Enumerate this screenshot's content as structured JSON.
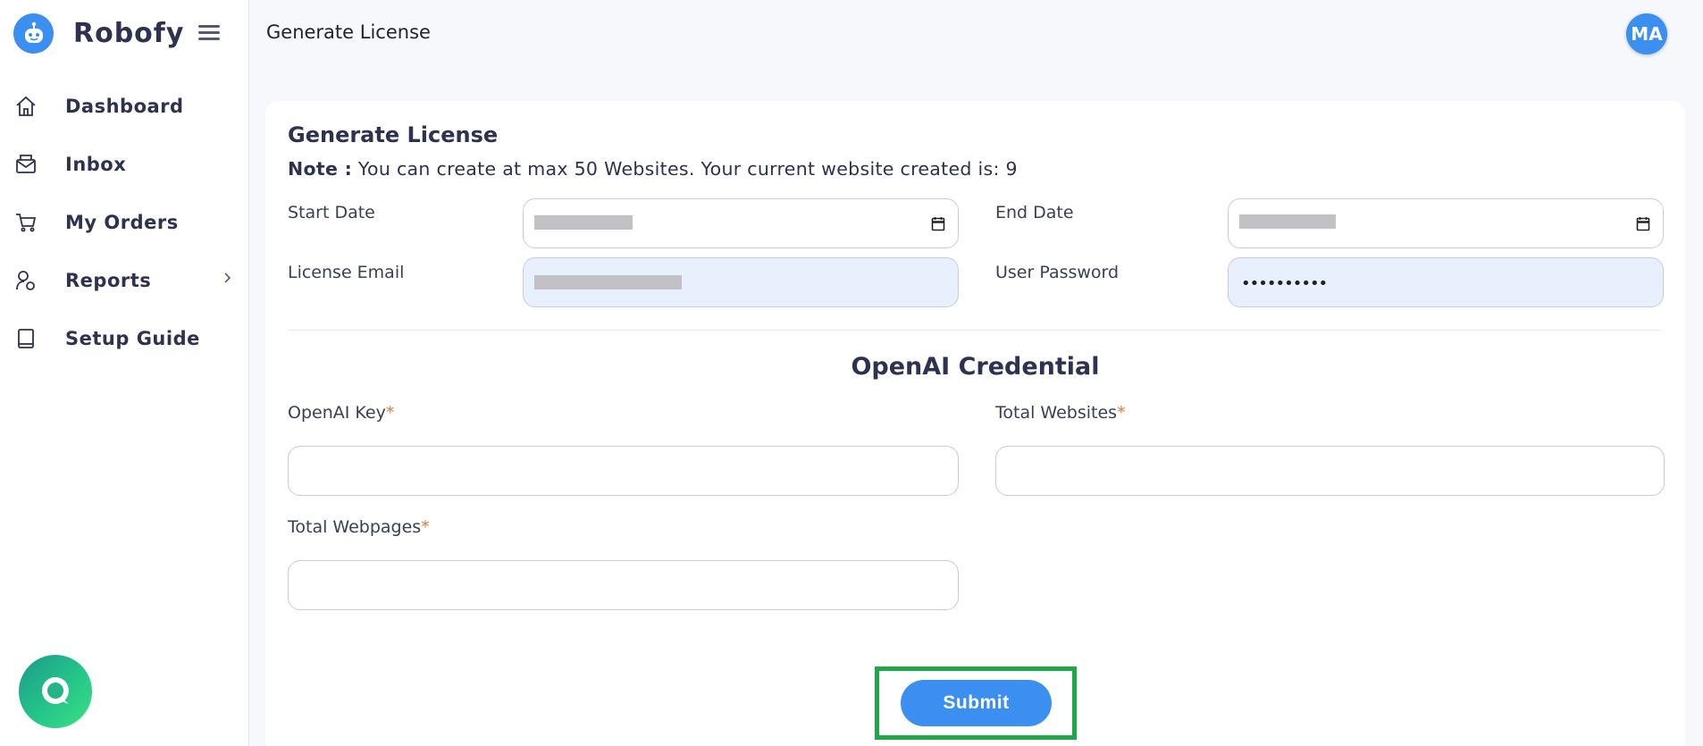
{
  "app": {
    "brand_name": "Robofy",
    "avatar_initials": "MA",
    "accent_color": "#3b8ff0"
  },
  "sidebar": {
    "items": [
      {
        "label": "Dashboard",
        "icon": "home-icon"
      },
      {
        "label": "Inbox",
        "icon": "inbox-icon"
      },
      {
        "label": "My Orders",
        "icon": "cart-icon"
      },
      {
        "label": "Reports",
        "icon": "reports-icon"
      },
      {
        "label": "Setup Guide",
        "icon": "book-icon"
      }
    ]
  },
  "header": {
    "title": "Generate License"
  },
  "form": {
    "title": "Generate License",
    "note_label": "Note :",
    "note_text": " You can create at max 50 Websites. Your current website created is: 9",
    "start_date_label": "Start Date",
    "end_date_label": "End Date",
    "license_email_label": "License Email",
    "user_password_label": "User Password",
    "user_password_mask": "••••••••••",
    "section_title": "OpenAI Credential",
    "openai_key_label": "OpenAI Key",
    "total_websites_label": "Total Websites",
    "total_webpages_label": "Total Webpages",
    "required_marker": "*",
    "submit_label": "Submit"
  }
}
